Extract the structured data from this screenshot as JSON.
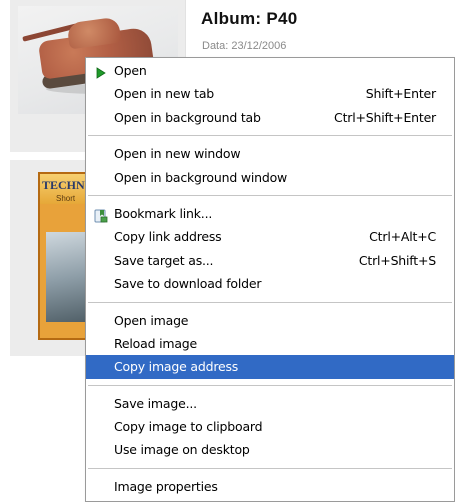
{
  "album": {
    "title": "Album: P40",
    "date": "Data: 23/12/2006"
  },
  "book": {
    "title": "TECHN",
    "subtitle": "Short"
  },
  "context_menu": {
    "sections": [
      [
        {
          "label": "Open",
          "shortcut": "",
          "icon": "green-arrow-icon"
        },
        {
          "label": "Open in new tab",
          "shortcut": "Shift+Enter"
        },
        {
          "label": "Open in background tab",
          "shortcut": "Ctrl+Shift+Enter"
        }
      ],
      [
        {
          "label": "Open in new window",
          "shortcut": ""
        },
        {
          "label": "Open in background window",
          "shortcut": ""
        }
      ],
      [
        {
          "label": "Bookmark link...",
          "shortcut": "",
          "icon": "bookmark-icon"
        },
        {
          "label": "Copy link address",
          "shortcut": "Ctrl+Alt+C"
        },
        {
          "label": "Save target as...",
          "shortcut": "Ctrl+Shift+S"
        },
        {
          "label": "Save to download folder",
          "shortcut": ""
        }
      ],
      [
        {
          "label": "Open image",
          "shortcut": ""
        },
        {
          "label": "Reload image",
          "shortcut": ""
        },
        {
          "label": "Copy image address",
          "shortcut": "",
          "highlighted": true
        }
      ],
      [
        {
          "label": "Save image...",
          "shortcut": ""
        },
        {
          "label": "Copy image to clipboard",
          "shortcut": ""
        },
        {
          "label": "Use image on desktop",
          "shortcut": ""
        }
      ],
      [
        {
          "label": "Image properties",
          "shortcut": ""
        }
      ]
    ],
    "highlight_color": "#316ac5"
  }
}
